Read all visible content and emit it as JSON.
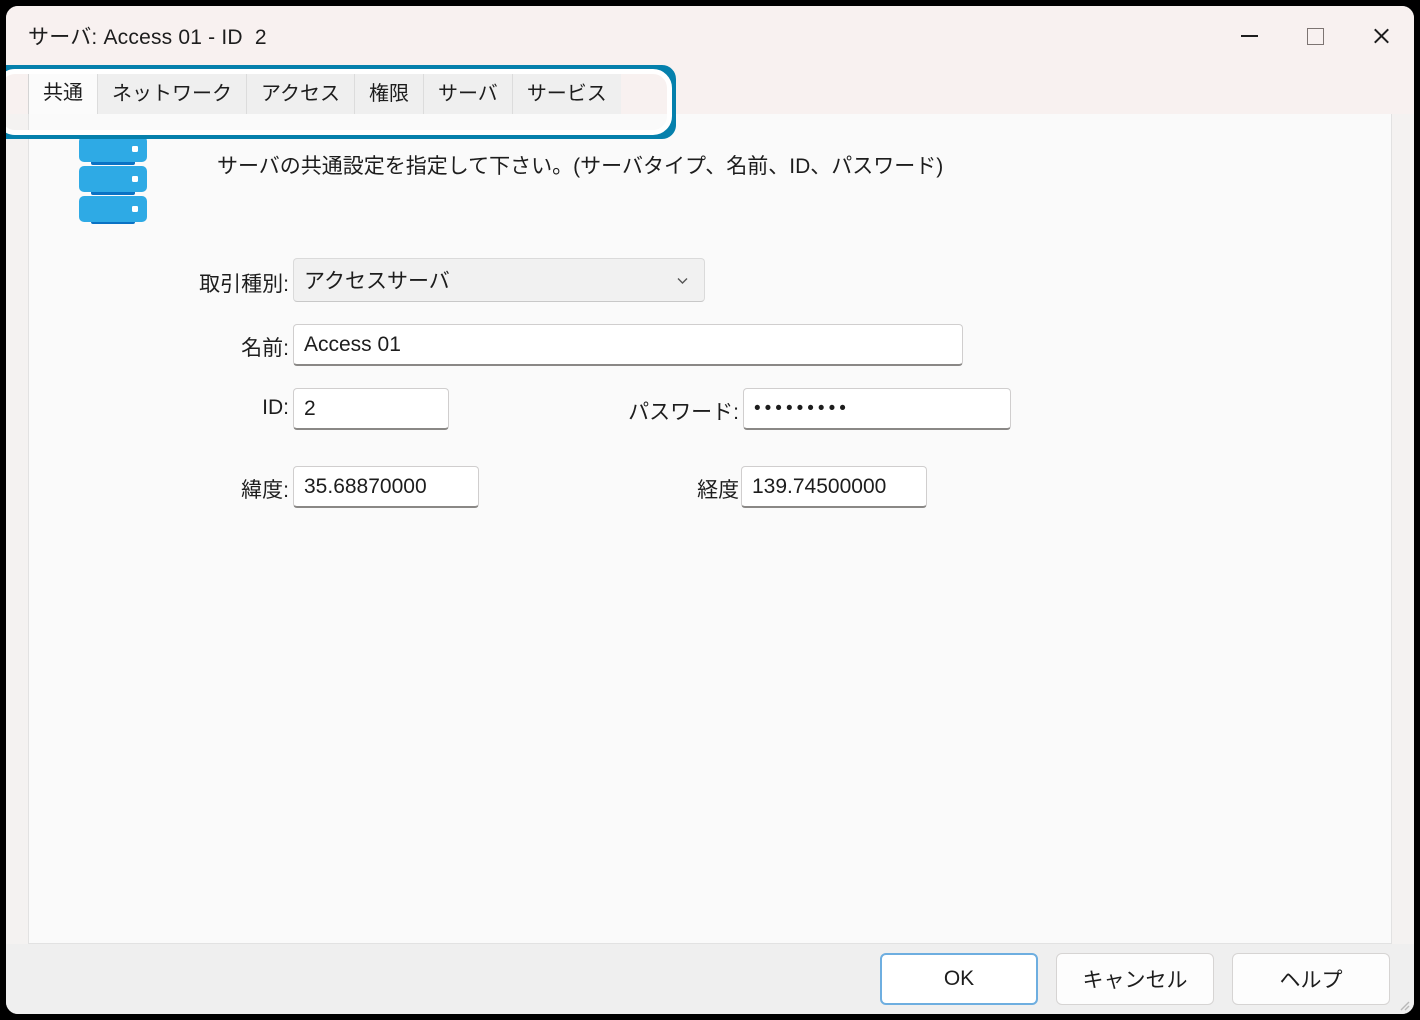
{
  "window": {
    "title": "サーバ: Access 01 - ID  2",
    "controls": {
      "minimize_label": "最小化",
      "maximize_label": "最大化",
      "close_label": "閉じる"
    }
  },
  "tabs": [
    {
      "label": "共通",
      "active": true
    },
    {
      "label": "ネットワーク",
      "active": false
    },
    {
      "label": "アクセス",
      "active": false
    },
    {
      "label": "権限",
      "active": false
    },
    {
      "label": "サーバ",
      "active": false
    },
    {
      "label": "サービス",
      "active": false
    }
  ],
  "content": {
    "icon_name": "server-stack-icon",
    "description": "サーバの共通設定を指定して下さい。(サーバタイプ、名前、ID、パスワード)"
  },
  "form": {
    "type": {
      "label": "取引種別:",
      "value": "アクセスサーバ",
      "options": [
        "アクセスサーバ"
      ]
    },
    "name": {
      "label": "名前:",
      "value": "Access 01"
    },
    "id": {
      "label": "ID:",
      "value": "2"
    },
    "password": {
      "label": "パスワード:",
      "value": "•••••••••",
      "dot_count": 9
    },
    "latitude": {
      "label": "緯度:",
      "value": "35.68870000"
    },
    "longitude": {
      "label": "経度:",
      "value": "139.74500000"
    }
  },
  "footer": {
    "ok_label": "OK",
    "cancel_label": "キャンセル",
    "help_label": "ヘルプ"
  },
  "colors": {
    "annotation_ring": "#0580ac",
    "titlebar_bg": "#f8f1f0",
    "content_bg": "#fafafa",
    "footer_bg": "#efefef",
    "icon_blue_light": "#2eaae5",
    "icon_blue_dark": "#0a72c4",
    "primary_focus_border": "#6eaee0"
  }
}
